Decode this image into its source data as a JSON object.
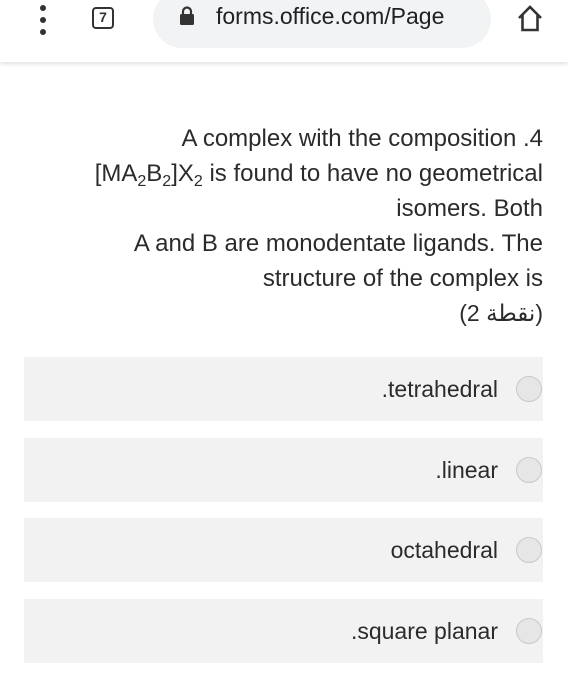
{
  "browser": {
    "tab_count": "7",
    "url": "forms.office.com/Page",
    "icons": [
      "menu-icon",
      "tab-switcher-icon",
      "lock-icon",
      "home-icon"
    ]
  },
  "question": {
    "line1_text": "A complex with the composition",
    "line1_number": ".4",
    "formula": {
      "open": "[MA",
      "sub1": "2",
      "b": "B",
      "sub2": "2",
      "close": "]X",
      "sub3": "2"
    },
    "line2_rest": " is found to have no geometrical",
    "line3": "isomers. Both",
    "line4": "A and B are monodentate ligands. The",
    "line5": "structure of the complex is",
    "points": "(2 نقطة)"
  },
  "options": [
    {
      "label": ".tetrahedral"
    },
    {
      "label": ".linear"
    },
    {
      "label": "octahedral"
    },
    {
      "label": ".square planar"
    }
  ],
  "colors": {
    "option_background": "#f2f2f2",
    "radio_border": "#c8c8c8",
    "text": "#2b2b2b"
  }
}
